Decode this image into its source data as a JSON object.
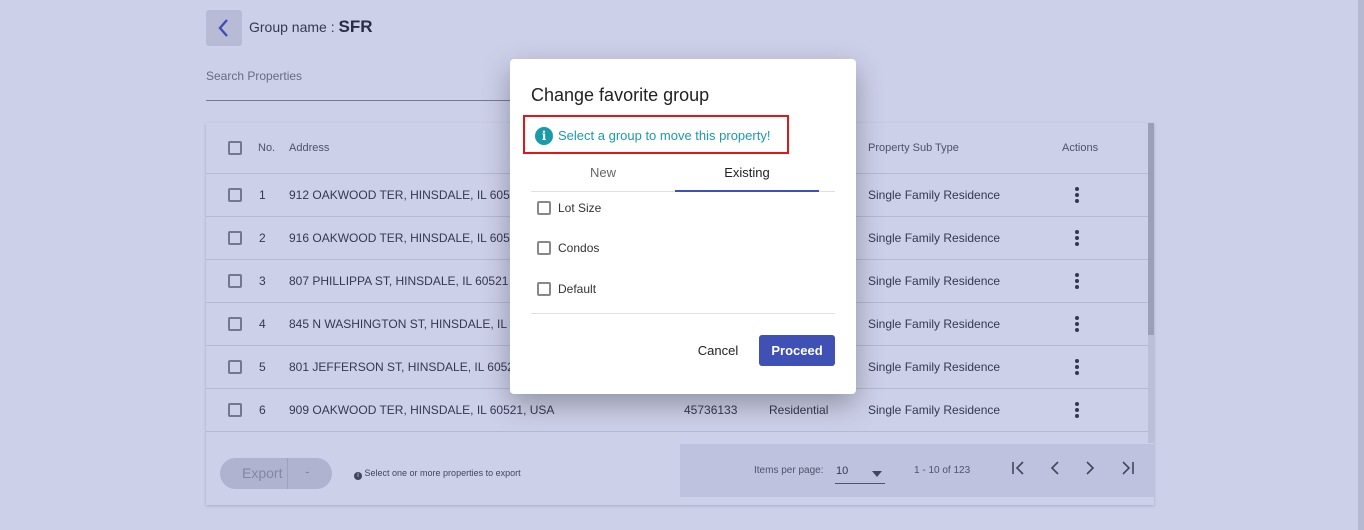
{
  "header": {
    "back_icon": "chevron-left-icon",
    "group_label": "Group name : ",
    "group_value": "SFR"
  },
  "search": {
    "label": "Search Properties"
  },
  "table": {
    "columns": {
      "no": "No.",
      "address": "Address",
      "sub_type": "Property Sub Type",
      "actions": "Actions"
    },
    "rows": [
      {
        "no": "1",
        "address": "912 OAKWOOD TER, HINSDALE, IL 6052",
        "sub_type": "Single Family Residence"
      },
      {
        "no": "2",
        "address": "916 OAKWOOD TER, HINSDALE, IL 6052",
        "sub_type": "Single Family Residence"
      },
      {
        "no": "3",
        "address": "807 PHILLIPPA ST, HINSDALE, IL 60521",
        "sub_type": "Single Family Residence"
      },
      {
        "no": "4",
        "address": "845 N WASHINGTON ST, HINSDALE, IL 6",
        "sub_type": "Single Family Residence"
      },
      {
        "no": "5",
        "address": "801 JEFFERSON ST, HINSDALE, IL 6052",
        "sub_type": "Single Family Residence"
      },
      {
        "no": "6",
        "address": "909 OAKWOOD TER, HINSDALE, IL 60521, USA",
        "id": "45736133",
        "type": "Residential",
        "sub_type": "Single Family Residence"
      }
    ]
  },
  "footer": {
    "export_label": "Export",
    "export_dash": "-",
    "export_note": "Select one or more properties to export",
    "items_per_page_label": "Items per page:",
    "items_per_page_value": "10",
    "range": "1 - 10 of 123"
  },
  "dialog": {
    "title": "Change favorite group",
    "info_icon": "info-icon",
    "info_text": "Select a group to move this property!",
    "tabs": [
      {
        "label": "New",
        "active": false
      },
      {
        "label": "Existing",
        "active": true
      }
    ],
    "options": [
      {
        "label": "Lot Size",
        "checked": false
      },
      {
        "label": "Condos",
        "checked": false
      },
      {
        "label": "Default",
        "checked": false
      }
    ],
    "cancel_label": "Cancel",
    "proceed_label": "Proceed"
  },
  "colors": {
    "primary": "#3f51b5",
    "info": "#1b9aaa",
    "highlight": "#e11616"
  }
}
